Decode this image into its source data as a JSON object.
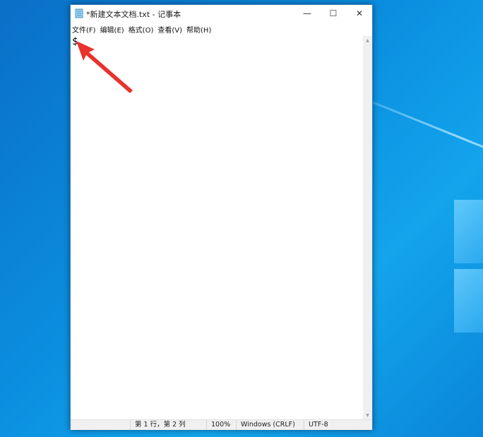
{
  "window": {
    "title": "*新建文本文档.txt - 记事本",
    "minimize_glyph": "—",
    "maximize_glyph": "☐",
    "close_glyph": "✕"
  },
  "menu": {
    "items": [
      {
        "label": "文件(F)"
      },
      {
        "label": "编辑(E)"
      },
      {
        "label": "格式(O)"
      },
      {
        "label": "查看(V)"
      },
      {
        "label": "帮助(H)"
      }
    ]
  },
  "editor": {
    "content": "$"
  },
  "statusbar": {
    "position": "第 1 行，第 2 列",
    "zoom": "100%",
    "line_ending": "Windows (CRLF)",
    "encoding": "UTF-8"
  },
  "icons": {
    "app": "notepad-icon",
    "annotation": "red-arrow-icon"
  },
  "colors": {
    "desktop_blue": "#0b8fe0",
    "arrow_red": "#e8322e",
    "statusbar_bg": "#f0f0f0"
  }
}
